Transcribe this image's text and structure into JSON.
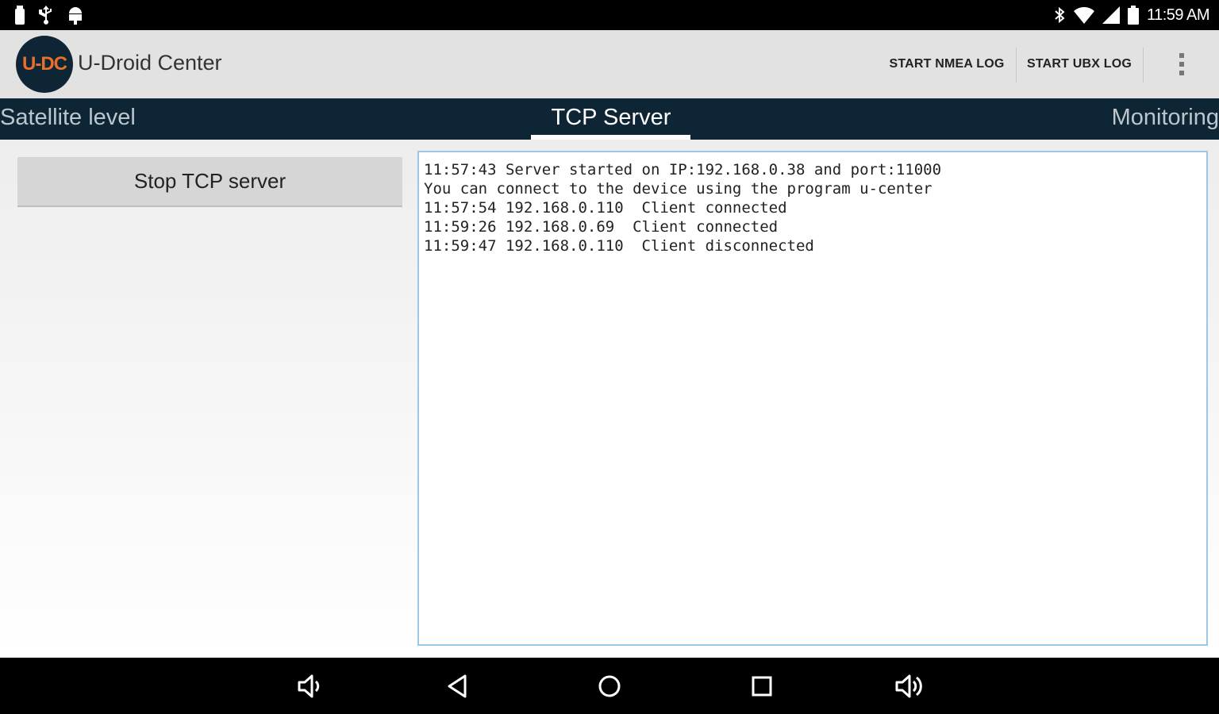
{
  "status_bar": {
    "time": "11:59 AM",
    "left_icons": [
      "notification-icon",
      "usb-icon",
      "android-debug-icon"
    ],
    "right_icons": [
      "bluetooth-icon",
      "wifi-icon",
      "cell-signal-icon",
      "battery-icon"
    ]
  },
  "action_bar": {
    "logo_text": "U-DC",
    "title": "U-Droid Center",
    "actions": [
      {
        "label": "START NMEA LOG"
      },
      {
        "label": "START UBX LOG"
      }
    ],
    "overflow_icon": "more-vert-icon"
  },
  "tabs": [
    {
      "label": "Satellite level",
      "selected": false
    },
    {
      "label": "TCP Server",
      "selected": true
    },
    {
      "label": "Monitoring",
      "selected": false
    }
  ],
  "main": {
    "stop_button_label": "Stop TCP server",
    "log_lines": [
      "11:57:43 Server started on IP:192.168.0.38 and port:11000",
      "You can connect to the device using the program u-center",
      "11:57:54 192.168.0.110  Client connected",
      "11:59:26 192.168.0.69  Client connected",
      "11:59:47 192.168.0.110  Client disconnected"
    ]
  },
  "nav_bar": {
    "buttons": [
      "volume-down-icon",
      "back-icon",
      "home-icon",
      "recents-icon",
      "volume-up-icon"
    ]
  },
  "colors": {
    "action_bar_bg": "#e2e2e2",
    "tab_bg": "#0d2535",
    "logo_accent": "#e8702a",
    "log_border": "#9cc8e8"
  }
}
